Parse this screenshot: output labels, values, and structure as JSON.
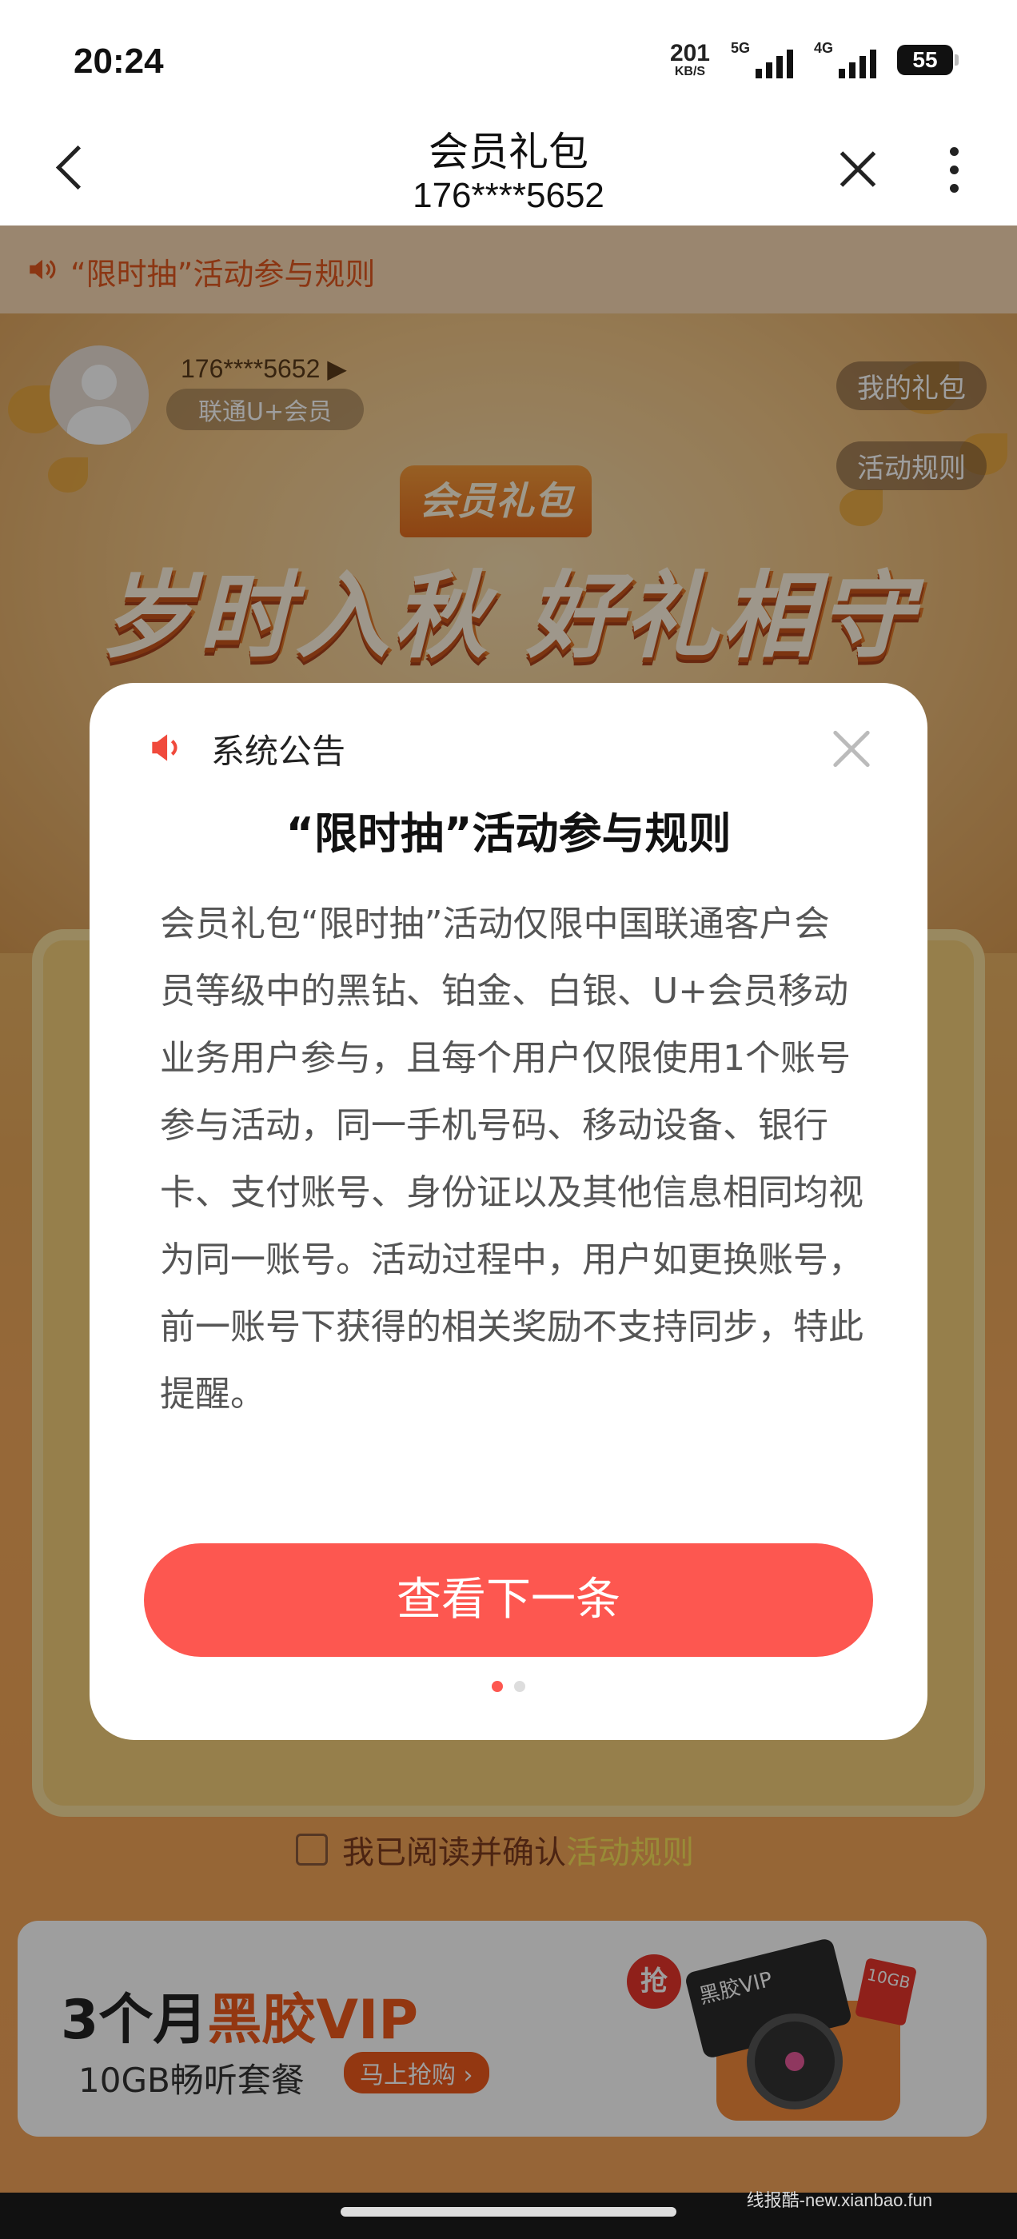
{
  "status_bar": {
    "time": "20:24",
    "net_speed_value": "201",
    "net_speed_unit": "KB/S",
    "signal1_label": "5G",
    "signal2_label": "4G",
    "battery": "55"
  },
  "header": {
    "title": "会员礼包",
    "subtitle": "176****5652"
  },
  "notice_bar": {
    "text": "“限时抽”活动参与规则"
  },
  "hero": {
    "user_phone": "176****5652 ▶",
    "member_level": "联通U+会员",
    "my_gifts_button": "我的礼包",
    "rules_button": "活动规则",
    "tag": "会员礼包",
    "title": "岁时入秋 好礼相守"
  },
  "agree": {
    "text": "我已阅读并确认",
    "link": "活动规则"
  },
  "promo": {
    "title_prefix": "3个月",
    "title_highlight": "黑胶VIP",
    "subtitle": "10GB畅听套餐",
    "button": "马上抢购 ›",
    "badge": "抢",
    "card_text": "黑胶VIP",
    "gb_tag": "10GB"
  },
  "modal": {
    "header": "系统公告",
    "title": "“限时抽”活动参与规则",
    "body": "会员礼包“限时抽”活动仅限中国联通客户会员等级中的黑钻、铂金、白银、U+会员移动业务用户参与，且每个用户仅限使用1个账号参与活动，同一手机号码、移动设备、银行卡、支付账号、身份证以及其他信息相同均视为同一账号。活动过程中，用户如更换账号，前一账号下获得的相关奖励不支持同步，特此提醒。",
    "button": "查看下一条",
    "page_count": 2,
    "current_page": 1
  },
  "watermark": "线报酷-new.xianbao.fun",
  "colors": {
    "accent_red": "#fd5750",
    "promo_orange": "#ee5a1c",
    "notice_orange": "#e0571f"
  },
  "icons": {
    "back": "chevron-left-icon",
    "close": "close-icon",
    "more": "more-vertical-icon",
    "speaker": "speaker-icon"
  }
}
